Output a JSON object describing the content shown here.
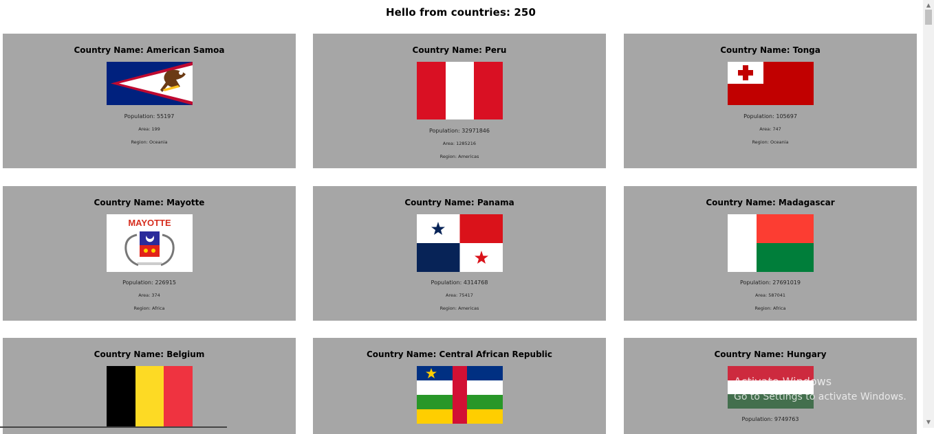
{
  "header": {
    "title": "Hello from countries: 250"
  },
  "countries": [
    {
      "name": "Country Name: American Samoa",
      "population": "Population: 55197",
      "area": "Area: 199",
      "region": "Region: Oceania",
      "flag_icon": "american-samoa-flag-icon"
    },
    {
      "name": "Country Name: Peru",
      "population": "Population: 32971846",
      "area": "Area: 1285216",
      "region": "Region: Americas",
      "flag_icon": "peru-flag-icon"
    },
    {
      "name": "Country Name: Tonga",
      "population": "Population: 105697",
      "area": "Area: 747",
      "region": "Region: Oceania",
      "flag_icon": "tonga-flag-icon"
    },
    {
      "name": "Country Name: Mayotte",
      "population": "Population: 226915",
      "area": "Area: 374",
      "region": "Region: Africa",
      "flag_icon": "mayotte-flag-icon",
      "flag_text": "MAYOTTE"
    },
    {
      "name": "Country Name: Panama",
      "population": "Population: 4314768",
      "area": "Area: 75417",
      "region": "Region: Americas",
      "flag_icon": "panama-flag-icon"
    },
    {
      "name": "Country Name: Madagascar",
      "population": "Population: 27691019",
      "area": "Area: 587041",
      "region": "Region: Africa",
      "flag_icon": "madagascar-flag-icon"
    },
    {
      "name": "Country Name: Belgium",
      "flag_icon": "belgium-flag-icon"
    },
    {
      "name": "Country Name: Central African Republic",
      "flag_icon": "central-african-republic-flag-icon"
    },
    {
      "name": "Country Name: Hungary",
      "population": "Population: 9749763",
      "flag_icon": "hungary-flag-icon"
    }
  ],
  "overlay": {
    "line1": "Activate Windows",
    "line2": "Go to Settings to activate Windows."
  }
}
